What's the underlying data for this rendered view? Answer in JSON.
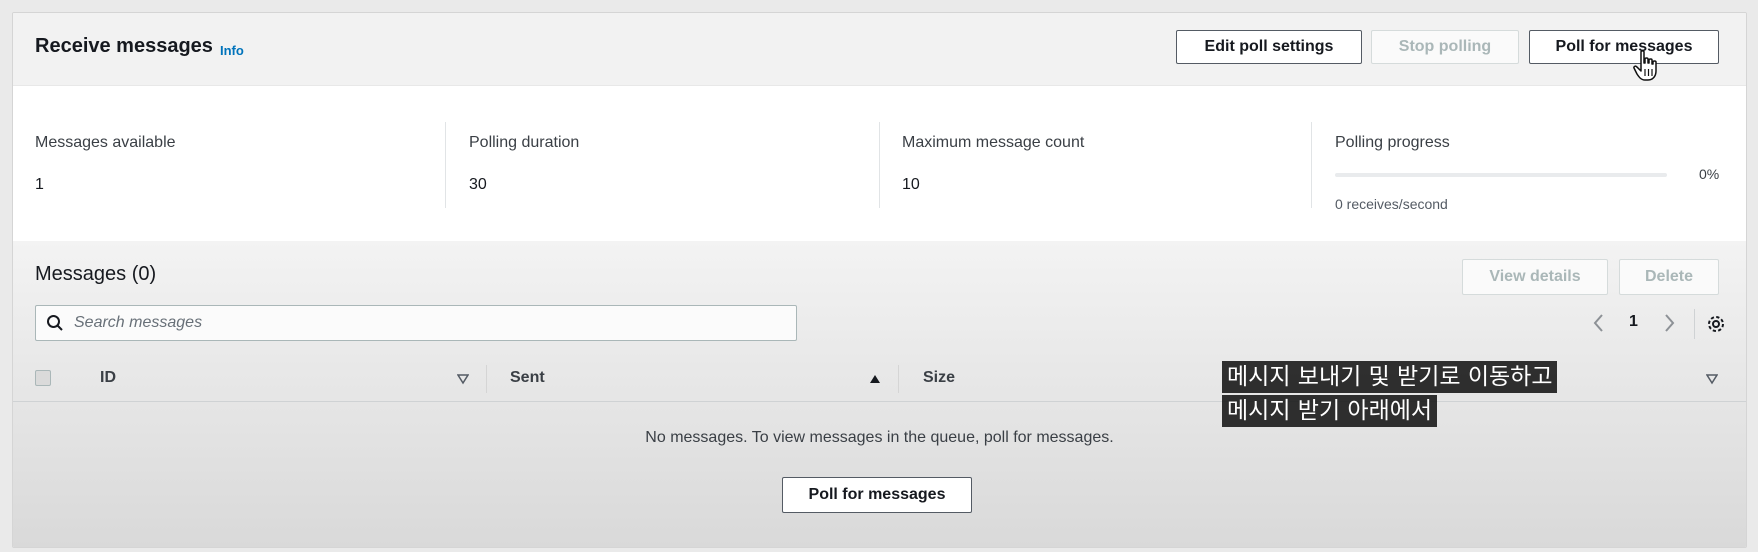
{
  "header": {
    "title": "Receive messages",
    "info": "Info",
    "buttons": {
      "edit_poll": "Edit poll settings",
      "stop_polling": "Stop polling",
      "poll": "Poll for messages"
    }
  },
  "stats": {
    "messages_available": {
      "label": "Messages available",
      "value": "1"
    },
    "polling_duration": {
      "label": "Polling duration",
      "value": "30"
    },
    "max_message_count": {
      "label": "Maximum message count",
      "value": "10"
    },
    "polling_progress": {
      "label": "Polling progress",
      "percent_text": "0%",
      "percent": 0,
      "rate": "0 receives/second"
    }
  },
  "messages": {
    "title": "Messages (0)",
    "view_details": "View details",
    "delete": "Delete",
    "search_placeholder": "Search messages",
    "page": "1",
    "columns": [
      "ID",
      "Sent",
      "Size"
    ],
    "empty_text": "No messages. To view messages in the queue, poll for messages.",
    "empty_button": "Poll for messages"
  },
  "subtitles": [
    "메시지 보내기 및 받기로 이동하고",
    "메시지 받기 아래에서"
  ],
  "colors": {
    "link": "#0073bb",
    "text": "#16191f",
    "disabled": "#aab7b8"
  }
}
